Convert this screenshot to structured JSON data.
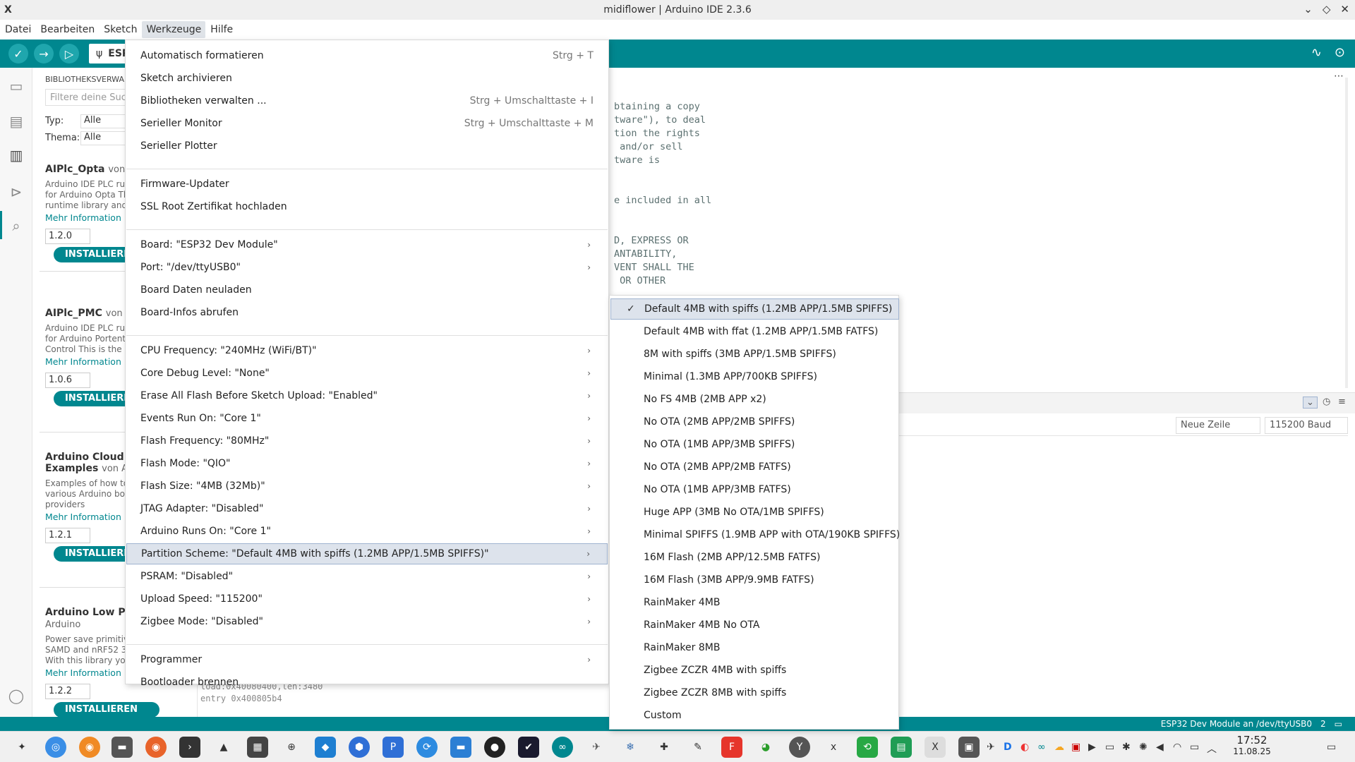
{
  "window": {
    "title": "midiflower | Arduino IDE 2.3.6"
  },
  "menubar": {
    "items": [
      "Datei",
      "Bearbeiten",
      "Sketch",
      "Werkzeuge",
      "Hilfe"
    ]
  },
  "toolbar": {
    "board_label": "ESP"
  },
  "library": {
    "title": "BIBLIOTHEKSVERWALT",
    "filter_placeholder": "Filtere deine Such",
    "typ_label": "Typ:",
    "typ_value": "Alle",
    "thema_label": "Thema:",
    "thema_value": "Alle",
    "cards": [
      {
        "name": "AIPlc_Opta",
        "by": "von Ar",
        "desc1": "Arduino IDE PLC runt",
        "desc2": "for Arduino Opta Thi",
        "desc3": "runtime library and p",
        "more": "Mehr Information",
        "version": "1.2.0",
        "install": "INSTALLIERE"
      },
      {
        "name": "AIPlc_PMC",
        "by": "von Ar",
        "desc1": "Arduino IDE PLC runt",
        "desc2": "for Arduino Portenta",
        "desc3": "Control This is the ru",
        "more": "Mehr Information",
        "version": "1.0.6",
        "install": "INSTALLIERE"
      },
      {
        "name": "Arduino Cloud Pr",
        "name2": "Examples",
        "by": "von Ar",
        "desc1": "Examples of how to",
        "desc2": "various Arduino boa",
        "desc3": "providers",
        "more": "Mehr Information",
        "version": "1.2.1",
        "install": "INSTALLIERE"
      },
      {
        "name": "Arduino Low Pow",
        "by2": "Arduino",
        "desc1": "Power save primitive",
        "desc2": "SAMD and nRF52 32l",
        "desc3": "With this library you",
        "more": "Mehr Information",
        "version": "1.2.2",
        "install": "INSTALLIEREN"
      }
    ]
  },
  "editor": {
    "lines": [
      "btaining a copy",
      "tware\"), to deal",
      "tion the rights",
      " and/or sell",
      "tware is",
      "",
      "",
      "e included in all",
      "",
      "",
      "D, EXPRESS OR",
      "ANTABILITY,",
      "VENT SHALL THE",
      " OR OTHER"
    ]
  },
  "output": {
    "line_ending": "Neue Zeile",
    "baud": "115200 Baud",
    "log1": "load:0x40080400,len:3480",
    "log2": "entry 0x400805b4"
  },
  "status": {
    "board_port": "ESP32 Dev Module an /dev/ttyUSB0",
    "notifications": "2"
  },
  "clock": {
    "time": "17:52",
    "date": "11.08.25"
  },
  "tools_menu": {
    "items": [
      {
        "label": "Automatisch formatieren",
        "shortcut": "Strg + T"
      },
      {
        "label": "Sketch archivieren"
      },
      {
        "label": "Bibliotheken verwalten ...",
        "shortcut": "Strg + Umschalttaste + I"
      },
      {
        "label": "Serieller Monitor",
        "shortcut": "Strg + Umschalttaste + M"
      },
      {
        "label": "Serieller Plotter"
      },
      {
        "label": "Firmware-Updater"
      },
      {
        "label": "SSL Root Zertifikat hochladen"
      },
      {
        "label": "Board: \"ESP32 Dev Module\"",
        "submenu": true
      },
      {
        "label": "Port: \"/dev/ttyUSB0\"",
        "submenu": true
      },
      {
        "label": "Board Daten neuladen"
      },
      {
        "label": "Board-Infos abrufen"
      },
      {
        "label": "CPU Frequency: \"240MHz (WiFi/BT)\"",
        "submenu": true
      },
      {
        "label": "Core Debug Level: \"None\"",
        "submenu": true
      },
      {
        "label": "Erase All Flash Before Sketch Upload: \"Enabled\"",
        "submenu": true
      },
      {
        "label": "Events Run On: \"Core 1\"",
        "submenu": true
      },
      {
        "label": "Flash Frequency: \"80MHz\"",
        "submenu": true
      },
      {
        "label": "Flash Mode: \"QIO\"",
        "submenu": true
      },
      {
        "label": "Flash Size: \"4MB (32Mb)\"",
        "submenu": true
      },
      {
        "label": "JTAG Adapter: \"Disabled\"",
        "submenu": true
      },
      {
        "label": "Arduino Runs On: \"Core 1\"",
        "submenu": true
      },
      {
        "label": "Partition Scheme: \"Default 4MB with spiffs (1.2MB APP/1.5MB SPIFFS)\"",
        "submenu": true,
        "highlighted": true
      },
      {
        "label": "PSRAM: \"Disabled\"",
        "submenu": true
      },
      {
        "label": "Upload Speed: \"115200\"",
        "submenu": true
      },
      {
        "label": "Zigbee Mode: \"Disabled\"",
        "submenu": true
      },
      {
        "label": "Programmer",
        "submenu": true
      },
      {
        "label": "Bootloader brennen"
      }
    ]
  },
  "partition_menu": {
    "selected_index": 0,
    "items": [
      "Default 4MB with spiffs (1.2MB APP/1.5MB SPIFFS)",
      "Default 4MB with ffat (1.2MB APP/1.5MB FATFS)",
      "8M with spiffs (3MB APP/1.5MB SPIFFS)",
      "Minimal (1.3MB APP/700KB SPIFFS)",
      "No FS 4MB (2MB APP x2)",
      "No OTA (2MB APP/2MB SPIFFS)",
      "No OTA (1MB APP/3MB SPIFFS)",
      "No OTA (2MB APP/2MB FATFS)",
      "No OTA (1MB APP/3MB FATFS)",
      "Huge APP (3MB No OTA/1MB SPIFFS)",
      "Minimal SPIFFS (1.9MB APP with OTA/190KB SPIFFS)",
      "16M Flash (2MB APP/12.5MB FATFS)",
      "16M Flash (3MB APP/9.9MB FATFS)",
      "RainMaker 4MB",
      "RainMaker 4MB No OTA",
      "RainMaker 8MB",
      "Zigbee ZCZR 4MB with spiffs",
      "Zigbee ZCZR 8MB with spiffs",
      "Custom"
    ]
  },
  "colors": {
    "accent": "#00878f",
    "highlight": "#dde3ec"
  }
}
